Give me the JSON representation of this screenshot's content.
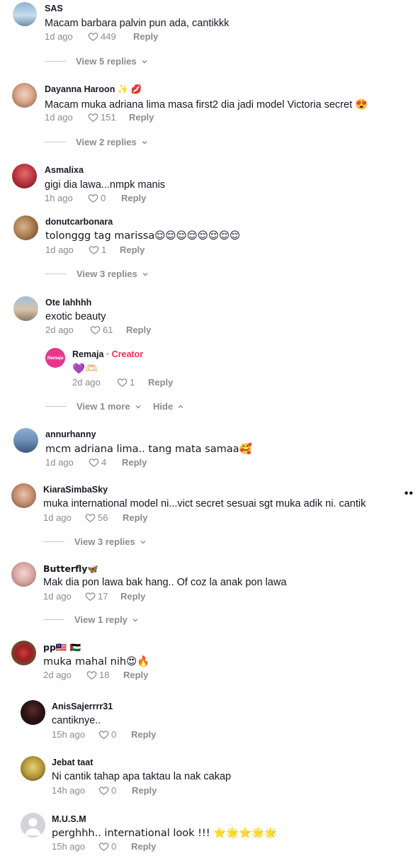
{
  "comments": [
    {
      "user": "SAS",
      "text": "Macam barbara palvin pun ada, cantikkk",
      "time": "1d ago",
      "likes": "449",
      "view": "View 5 replies"
    },
    {
      "user": "Dayanna Haroon ✨ 💋",
      "text": "Macam muka adriana lima masa first2 dia jadi model Victoria secret 😍",
      "time": "1d ago",
      "likes": "151",
      "view": "View 2 replies"
    },
    {
      "user": "Asmalixa",
      "text": "gigi dia lawa...nmpk manis",
      "time": "1h ago",
      "likes": "0"
    },
    {
      "user": "donutcarbonara",
      "text": "tolonggg tag marissa😌😌😌😌😌😌😌😌",
      "time": "1d ago",
      "likes": "1",
      "view": "View 3 replies"
    },
    {
      "user": "Ote lahhhh",
      "text": "exotic beauty",
      "time": "2d ago",
      "likes": "61"
    },
    {
      "user": "annurhanny",
      "text": "mcm adriana lima.. tang mata samaa🥰",
      "time": "1d ago",
      "likes": "4"
    },
    {
      "user": "KiaraSimbaSky",
      "text": "muka international model ni...vict secret sesuai sgt muka adik ni. cantik",
      "time": "1d ago",
      "likes": "56",
      "view": "View 3 replies"
    },
    {
      "user": "Butterfly🦋",
      "text": "Mak dia pon lawa bak hang.. Of coz la anak pon lawa",
      "time": "1d ago",
      "likes": "17",
      "view": "View 1 reply"
    },
    {
      "user": "pp🇲🇾 🇵🇸",
      "text": "muka mahal nih😍🔥",
      "time": "2d ago",
      "likes": "18"
    },
    {
      "user": "AnisSajerrrr31",
      "text": "cantiknye..",
      "time": "15h ago",
      "likes": "0"
    },
    {
      "user": "Jebat taat",
      "text": "Ni cantik tahap apa taktau la nak cakap",
      "time": "14h ago",
      "likes": "0"
    },
    {
      "user": "M.U.S.M",
      "text": "perghhh.. international look !!! ⭐🌟⭐🌟🌟",
      "time": "15h ago",
      "likes": "0"
    }
  ],
  "creator_reply": {
    "user": "Remaja",
    "badge": "· Creator",
    "text": "💜🫶🏻",
    "time": "2d ago",
    "likes": "1",
    "avatar_text": "Remaja"
  },
  "reply_thread": {
    "view_more": "View 1 more",
    "hide": "Hide"
  },
  "reply_label": "Reply",
  "more_glyph": "••",
  "colors": {
    "accent": "#fe2c55",
    "meta": "#8a8b91",
    "text": "#161823"
  }
}
